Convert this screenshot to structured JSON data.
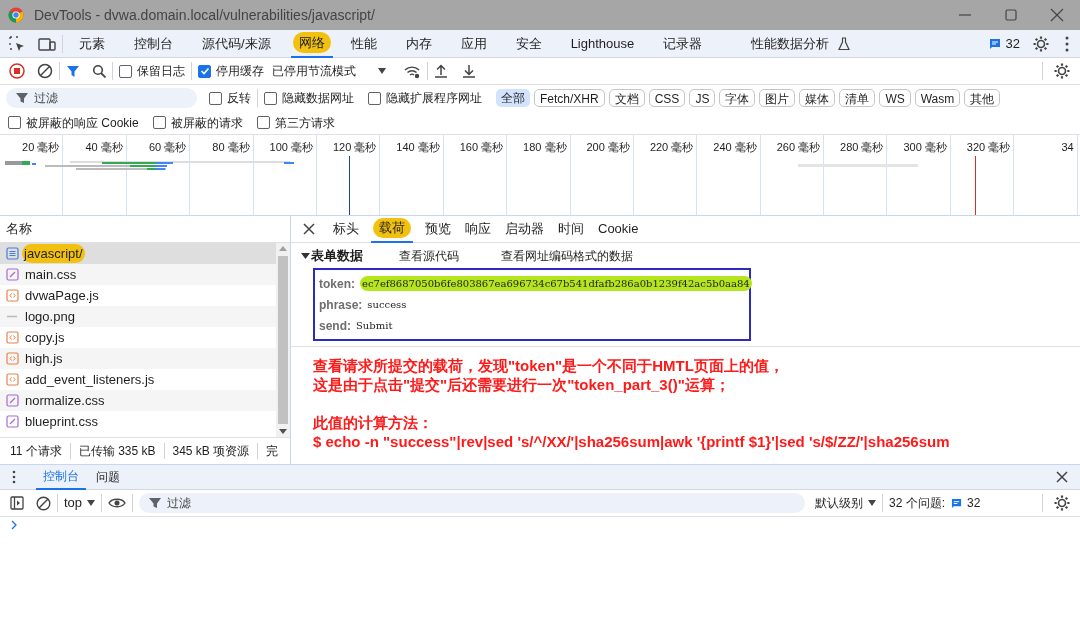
{
  "window": {
    "title": "DevTools - dvwa.domain.local/vulnerabilities/javascript/"
  },
  "tabs": [
    {
      "label": "元素",
      "selected": false
    },
    {
      "label": "控制台",
      "selected": false
    },
    {
      "label": "源代码/来源",
      "selected": false
    },
    {
      "label": "网络",
      "selected": true
    },
    {
      "label": "性能",
      "selected": false
    },
    {
      "label": "内存",
      "selected": false
    },
    {
      "label": "应用",
      "selected": false
    },
    {
      "label": "安全",
      "selected": false
    },
    {
      "label": "Lighthouse",
      "selected": false
    },
    {
      "label": "记录器",
      "selected": false
    },
    {
      "label": "性能数据分析",
      "selected": false
    }
  ],
  "issues_badge": "32",
  "toolbar": {
    "checkboxes": [
      {
        "label": "保留日志",
        "checked": false
      },
      {
        "label": "停用缓存",
        "checked": true
      }
    ],
    "throttling": "已停用节流模式"
  },
  "filter": {
    "placeholder": "过滤",
    "checkboxes": [
      {
        "label": "反转",
        "checked": false
      },
      {
        "label": "隐藏数据网址",
        "checked": false
      },
      {
        "label": "隐藏扩展程序网址",
        "checked": false
      }
    ],
    "types": [
      {
        "label": "全部",
        "selected": true
      },
      {
        "label": "Fetch/XHR",
        "selected": false
      },
      {
        "label": "文档",
        "selected": false
      },
      {
        "label": "CSS",
        "selected": false
      },
      {
        "label": "JS",
        "selected": false
      },
      {
        "label": "字体",
        "selected": false
      },
      {
        "label": "图片",
        "selected": false
      },
      {
        "label": "媒体",
        "selected": false
      },
      {
        "label": "清单",
        "selected": false
      },
      {
        "label": "WS",
        "selected": false
      },
      {
        "label": "Wasm",
        "selected": false
      },
      {
        "label": "其他",
        "selected": false
      }
    ],
    "more_checkboxes": [
      {
        "label": "被屏蔽的响应 Cookie",
        "checked": false
      },
      {
        "label": "被屏蔽的请求",
        "checked": false
      },
      {
        "label": "第三方请求",
        "checked": false
      }
    ]
  },
  "timeline": {
    "ticks": [
      "20 毫秒",
      "40 毫秒",
      "60 毫秒",
      "80 毫秒",
      "100 毫秒",
      "120 毫秒",
      "140 毫秒",
      "160 毫秒",
      "180 毫秒",
      "200 毫秒",
      "220 毫秒",
      "240 毫秒",
      "260 毫秒",
      "280 毫秒",
      "300 毫秒",
      "320 毫秒",
      "34"
    ]
  },
  "requests": {
    "column": "名称",
    "rows": [
      {
        "name": "javascript/",
        "kind": "doc",
        "selected": true
      },
      {
        "name": "main.css",
        "kind": "css",
        "selected": false
      },
      {
        "name": "dvwaPage.js",
        "kind": "js",
        "selected": false
      },
      {
        "name": "logo.png",
        "kind": "img",
        "selected": false
      },
      {
        "name": "copy.js",
        "kind": "js",
        "selected": false
      },
      {
        "name": "high.js",
        "kind": "js",
        "selected": false
      },
      {
        "name": "add_event_listeners.js",
        "kind": "js",
        "selected": false
      },
      {
        "name": "normalize.css",
        "kind": "css",
        "selected": false
      },
      {
        "name": "blueprint.css",
        "kind": "css",
        "selected": false
      }
    ]
  },
  "status_bar": [
    "11 个请求",
    "已传输 335 kB",
    "345 kB 项资源",
    "完"
  ],
  "detail": {
    "tabs": [
      {
        "label": "标头",
        "selected": false
      },
      {
        "label": "载荷",
        "selected": true
      },
      {
        "label": "预览",
        "selected": false
      },
      {
        "label": "响应",
        "selected": false
      },
      {
        "label": "启动器",
        "selected": false
      },
      {
        "label": "时间",
        "selected": false
      },
      {
        "label": "Cookie",
        "selected": false
      }
    ],
    "section": "表单数据",
    "links": [
      "查看源代码",
      "查看网址编码格式的数据"
    ],
    "form_data": [
      {
        "key": "token:",
        "value": "ec7ef8687050b6fe803867ea696734c67b541dfafb286a0b1239f42ac5b0aa84",
        "highlighted": true
      },
      {
        "key": "phrase:",
        "value": "success",
        "highlighted": false
      },
      {
        "key": "send:",
        "value": "Submit",
        "highlighted": false
      }
    ],
    "annotation": [
      [
        "查看请求所提交的载荷，发现\"token\"是一个不同于HMTL页面上的值，",
        "这是由于点击\"提交\"后还需要进行一次\"token_part_3()\"运算；"
      ],
      [
        "此值的计算方法：",
        "$ echo -n \"success\"|rev|sed 's/^/XX/'|sha256sum|awk '{printf $1}'|sed 's/$/ZZ/'|sha256sum"
      ]
    ]
  },
  "drawer": {
    "tabs": [
      {
        "label": "控制台",
        "selected": true
      },
      {
        "label": "问题",
        "selected": false
      }
    ],
    "context": "top",
    "filter_placeholder": "过滤",
    "level": "默认级别",
    "issues_label": "32 个问题:",
    "issues_count": "32"
  }
}
